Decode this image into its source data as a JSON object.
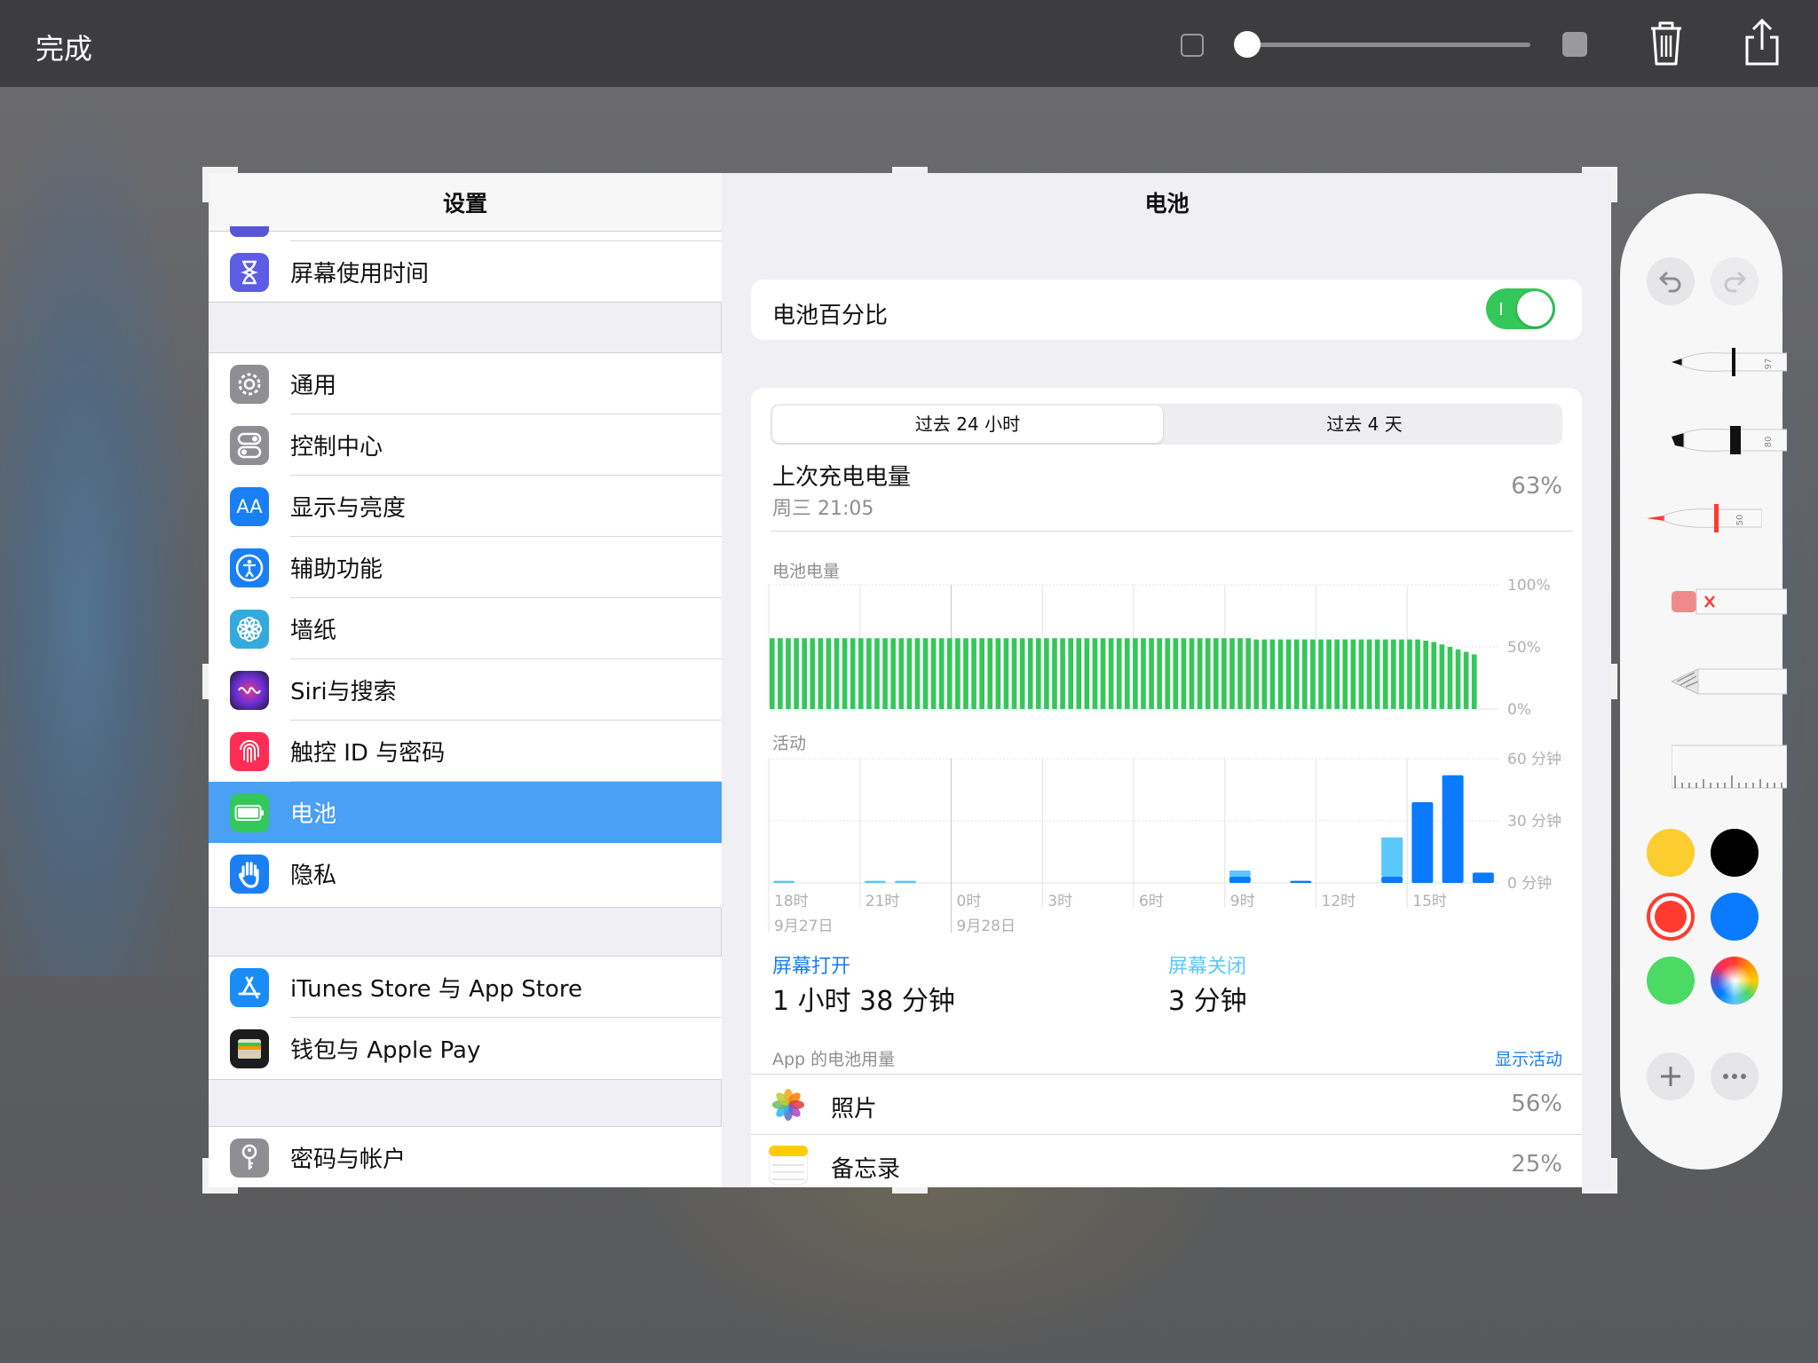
{
  "topbar": {
    "done_label": "完成"
  },
  "sidebar": {
    "title": "设置",
    "screen_time": "屏幕使用时间",
    "group2": [
      "通用",
      "控制中心",
      "显示与亮度",
      "辅助功能",
      "墙纸",
      "Siri与搜索",
      "触控 ID 与密码",
      "电池",
      "隐私"
    ],
    "display_icon_text": "AA",
    "group3": [
      "iTunes Store 与 App Store",
      "钱包与 Apple Pay"
    ],
    "group4": [
      "密码与帐户"
    ]
  },
  "main": {
    "title": "电池",
    "battery_percent_label": "电池百分比",
    "battery_percent_on": true,
    "segment": {
      "active": "过去 24 小时",
      "inactive": "过去 4 天"
    },
    "last_charge": {
      "label": "上次充电电量",
      "time": "周三 21:05",
      "value": "63%"
    },
    "battery_section_label": "电池电量",
    "activity_section_label": "活动",
    "screen_on": {
      "label": "屏幕打开",
      "value": "1 小时 38 分钟"
    },
    "screen_off": {
      "label": "屏幕关闭",
      "value": "3 分钟"
    },
    "app_usage_label": "App 的电池用量",
    "show_activity": "显示活动",
    "apps": [
      {
        "name": "照片",
        "value": "56%"
      },
      {
        "name": "备忘录",
        "value": "25%"
      }
    ]
  },
  "chart_data": [
    {
      "type": "bar",
      "title": "电池电量",
      "ylabels": [
        "100%",
        "50%",
        "0%"
      ],
      "ylim": [
        0,
        100
      ],
      "color": "#34c759",
      "bars": 88,
      "values_summary": "≈57% flat across 24 h, tapering to ≈43% at end",
      "values": [
        57,
        57,
        57,
        57,
        57,
        57,
        57,
        57,
        57,
        57,
        57,
        57,
        57,
        57,
        57,
        57,
        57,
        57,
        57,
        57,
        57,
        57,
        57,
        57,
        57,
        57,
        57,
        57,
        57,
        57,
        57,
        57,
        57,
        57,
        57,
        57,
        57,
        57,
        57,
        57,
        57,
        57,
        57,
        57,
        57,
        57,
        57,
        57,
        57,
        57,
        57,
        57,
        57,
        57,
        57,
        57,
        57,
        57,
        57,
        57,
        56,
        56,
        56,
        56,
        56,
        56,
        56,
        56,
        56,
        56,
        56,
        56,
        56,
        56,
        56,
        56,
        56,
        56,
        56,
        56,
        56,
        55,
        54,
        52,
        50,
        48,
        46,
        44
      ]
    },
    {
      "type": "bar",
      "title": "活动",
      "ylabels": [
        "60 分钟",
        "30 分钟",
        "0 分钟"
      ],
      "ylim": [
        0,
        60
      ],
      "xticks": [
        "18时",
        "21时",
        "0时",
        "3时",
        "6时",
        "9时",
        "12时",
        "15时"
      ],
      "xsub": [
        "9月27日",
        "",
        "9月28日",
        "",
        "",
        "",
        "",
        ""
      ],
      "series": [
        {
          "name": "屏幕打开",
          "color": "#0a7aff",
          "values": [
            0,
            0,
            0,
            0,
            0,
            0,
            0,
            0,
            0,
            0,
            0,
            0,
            0,
            0,
            0,
            0,
            0,
            0,
            0,
            0,
            0,
            0,
            0,
            0,
            0,
            0,
            0,
            0,
            0,
            0,
            0,
            0,
            0,
            0,
            0,
            0,
            0,
            0,
            0,
            0,
            0,
            0,
            0,
            0,
            0,
            0,
            0,
            0,
            0,
            0,
            0,
            0,
            0,
            0,
            0,
            0,
            0,
            0,
            0,
            0,
            0,
            0,
            0,
            0,
            0,
            0,
            0,
            0,
            0,
            0,
            0,
            0,
            0,
            0,
            0,
            0,
            0,
            0,
            0,
            0,
            0,
            0,
            0,
            0,
            0,
            0,
            0,
            0,
            0,
            0,
            0,
            0,
            0,
            0,
            0,
            0,
            0
          ]
        },
        {
          "name": "屏幕关闭",
          "color": "#5ac8fa",
          "values": []
        }
      ],
      "hour_bars": [
        {
          "hour": 0,
          "on": 0,
          "off": 1
        },
        {
          "hour": 3,
          "on": 0,
          "off": 1
        },
        {
          "hour": 4,
          "on": 0,
          "off": 1
        },
        {
          "hour": 15,
          "on": 3,
          "off": 3
        },
        {
          "hour": 17,
          "on": 1,
          "off": 0
        },
        {
          "hour": 20,
          "on": 3,
          "off": 19
        },
        {
          "hour": 21,
          "on": 39,
          "off": 0
        },
        {
          "hour": 22,
          "on": 52,
          "off": 0
        },
        {
          "hour": 23,
          "on": 5,
          "off": 0
        }
      ]
    }
  ],
  "markup": {
    "pens": [
      "97",
      "80",
      "50"
    ],
    "colors": [
      "#fdcc2e",
      "#000000",
      "#ff3b30",
      "#0a7aff",
      "#4cd964"
    ]
  }
}
